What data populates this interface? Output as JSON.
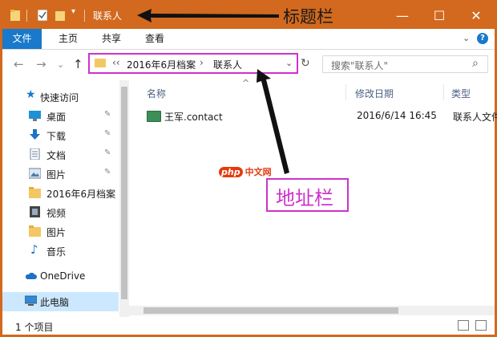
{
  "titlebar": {
    "title": "联系人",
    "annotation": "标题栏",
    "minimize": "—",
    "maximize": "☐",
    "close": "✕"
  },
  "ribbon": {
    "tabs": [
      "文件",
      "主页",
      "共享",
      "查看"
    ],
    "expand": "⌄",
    "help": "?"
  },
  "nav": {
    "back": "←",
    "forward": "→",
    "recent": "⌄",
    "up": "↑",
    "overflow": "‹‹",
    "breadcrumb": [
      "2016年6月档案",
      "联系人"
    ],
    "separator": "›",
    "dropdown": "⌄",
    "refresh": "↻",
    "search_placeholder": "搜索\"联系人\"",
    "search_icon": "⌕"
  },
  "sidebar": {
    "items": [
      {
        "label": "快速访问",
        "icon": "star-icon",
        "pinned": false
      },
      {
        "label": "桌面",
        "icon": "desktop-icon",
        "pinned": true
      },
      {
        "label": "下载",
        "icon": "download-icon",
        "pinned": true
      },
      {
        "label": "文档",
        "icon": "document-icon",
        "pinned": true
      },
      {
        "label": "图片",
        "icon": "picture-icon",
        "pinned": true
      },
      {
        "label": "2016年6月档案",
        "icon": "folder-icon",
        "pinned": false
      },
      {
        "label": "视频",
        "icon": "video-icon",
        "pinned": false
      },
      {
        "label": "图片",
        "icon": "folder-icon",
        "pinned": false
      },
      {
        "label": "音乐",
        "icon": "music-icon",
        "pinned": false
      },
      {
        "label": "OneDrive",
        "icon": "cloud-icon",
        "pinned": false
      },
      {
        "label": "此电脑",
        "icon": "computer-icon",
        "pinned": false
      }
    ],
    "pin_glyph": "✎"
  },
  "content": {
    "columns": [
      "名称",
      "修改日期",
      "类型"
    ],
    "sort_indicator": "^",
    "files": [
      {
        "name": "王军.contact",
        "modified": "2016/6/14 16:45",
        "type": "联系人文件"
      }
    ]
  },
  "status": {
    "count": "1 个项目"
  },
  "annotations": {
    "address_label": "地址栏",
    "logo_php": "php",
    "logo_cn": "中文网"
  },
  "colors": {
    "frame": "#d2691e",
    "ribbon_accent": "#1979ca",
    "annotation": "#cc33cc"
  }
}
